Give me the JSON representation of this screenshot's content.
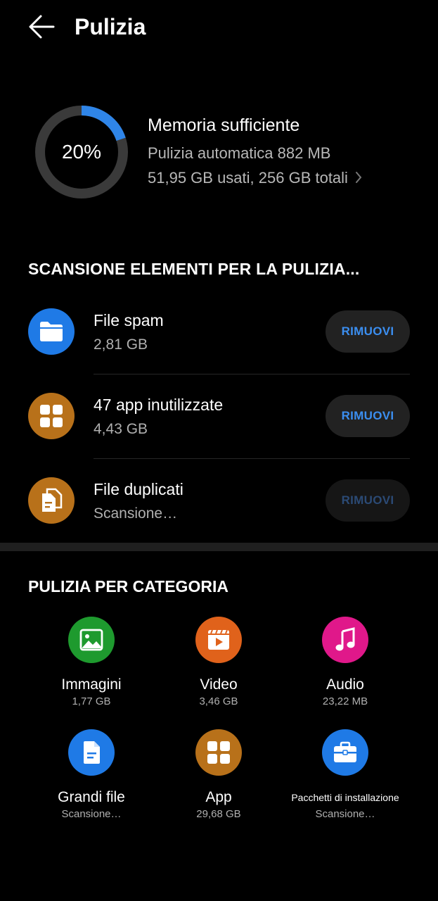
{
  "header": {
    "title": "Pulizia",
    "back_icon": "arrow-left-icon"
  },
  "storage": {
    "percent_label": "20%",
    "percent_value": 0.2,
    "title": "Memoria sufficiente",
    "auto_clean": "Pulizia automatica 882 MB",
    "usage": "51,95 GB usati, 256 GB totali",
    "ring_color": "#2f85e8",
    "track_color": "#3a3a3a"
  },
  "scan": {
    "heading": "SCANSIONE ELEMENTI PER LA PULIZIA...",
    "items": [
      {
        "title": "File spam",
        "subtitle": "2,81 GB",
        "button": "RIMUOVI",
        "icon": "folder-icon",
        "icon_bg": "#1f7ae6",
        "enabled": true
      },
      {
        "title": "47 app inutilizzate",
        "subtitle": "4,43 GB",
        "button": "RIMUOVI",
        "icon": "apps-grid-icon",
        "icon_bg": "#b8711a",
        "enabled": true
      },
      {
        "title": "File duplicati",
        "subtitle": "Scansione…",
        "button": "RIMUOVI",
        "icon": "duplicate-files-icon",
        "icon_bg": "#b8711a",
        "enabled": false
      }
    ]
  },
  "categories": {
    "heading": "PULIZIA PER CATEGORIA",
    "items": [
      {
        "label": "Immagini",
        "value": "1,77 GB",
        "icon": "image-icon",
        "color": "#1e9a2e"
      },
      {
        "label": "Video",
        "value": "3,46 GB",
        "icon": "video-icon",
        "color": "#e0621b"
      },
      {
        "label": "Audio",
        "value": "23,22 MB",
        "icon": "music-note-icon",
        "color": "#e0188a"
      },
      {
        "label": "Grandi file",
        "value": "Scansione…",
        "icon": "document-icon",
        "color": "#1f7ae6"
      },
      {
        "label": "App",
        "value": "29,68 GB",
        "icon": "apps-grid-icon",
        "color": "#b8711a"
      },
      {
        "label": "Pacchetti di installazione",
        "value": "Scansione…",
        "icon": "briefcase-icon",
        "color": "#1f7ae6"
      }
    ]
  }
}
